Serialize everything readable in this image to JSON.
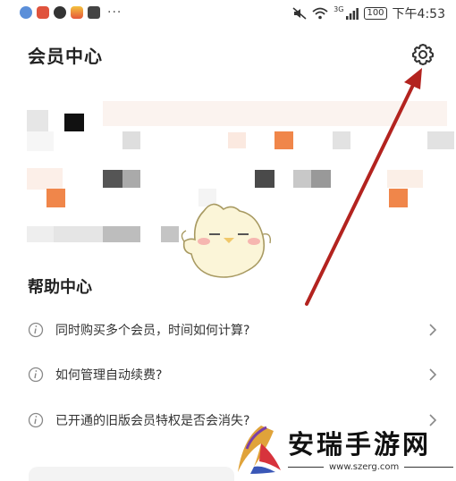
{
  "statusbar": {
    "dots": "···",
    "network": "3G",
    "battery": "100",
    "time": "下午4:53"
  },
  "header": {
    "title": "会员中心"
  },
  "help": {
    "title": "帮助中心",
    "items": [
      {
        "label": "同时购买多个会员，时间如何计算?"
      },
      {
        "label": "如何管理自动续费?"
      },
      {
        "label": "已开通的旧版会员特权是否会消失?"
      }
    ]
  },
  "watermark": {
    "title": "安瑞手游网",
    "url": "www.szerg.com"
  },
  "colors": {
    "accent_orange": "#f0864a",
    "annotation_red": "#b3231f"
  }
}
